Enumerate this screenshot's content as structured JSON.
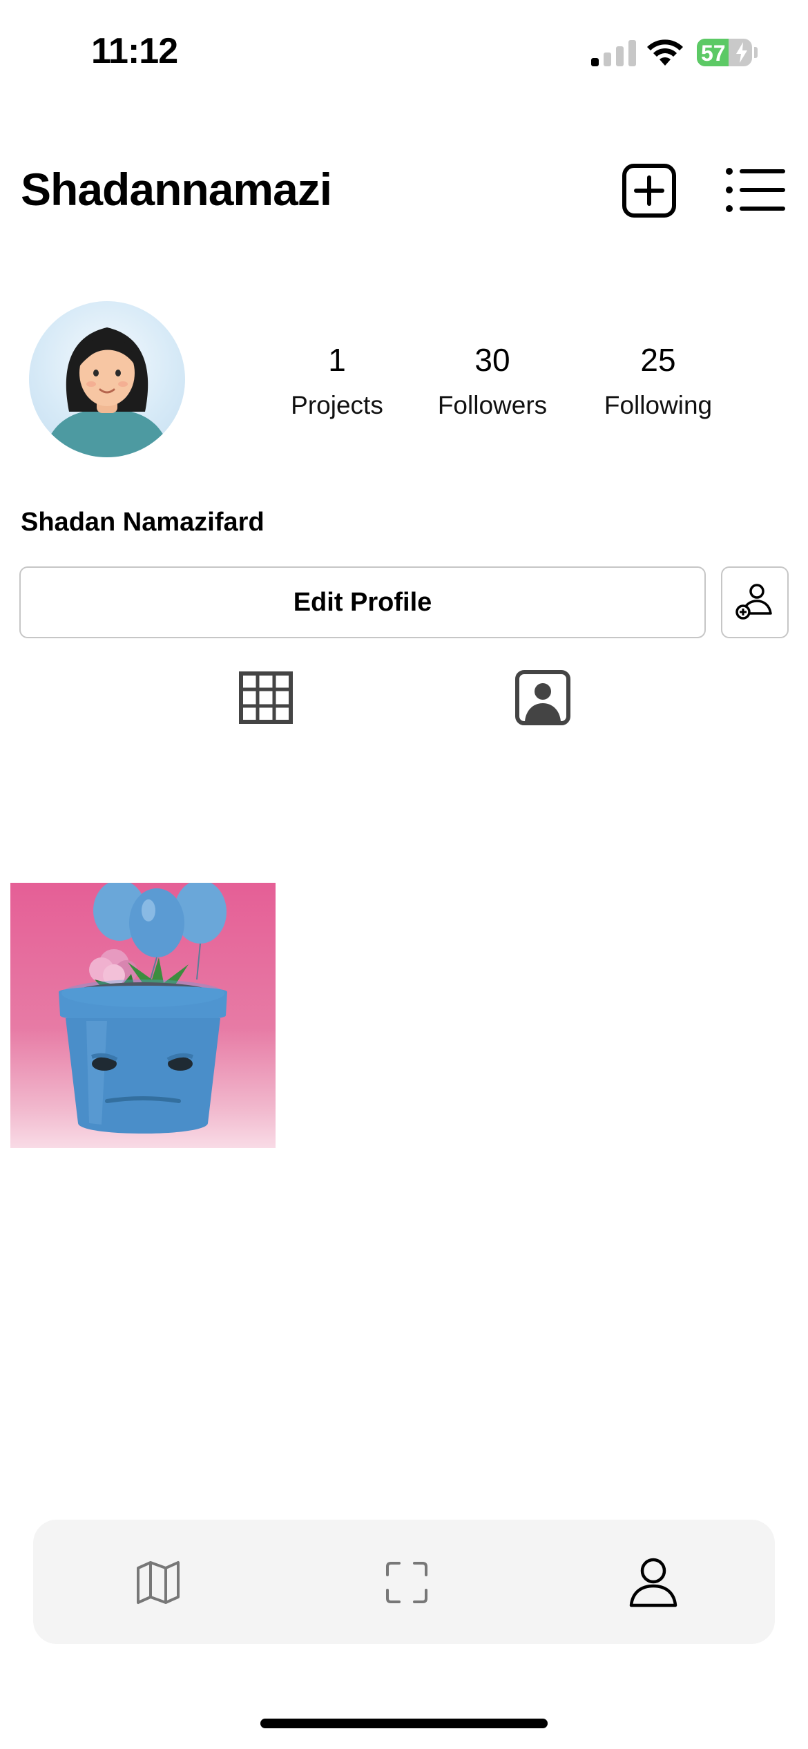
{
  "status_bar": {
    "time": "11:12",
    "battery_percent": "57",
    "battery_level": 0.57,
    "signal_bars_on": 1,
    "signal_bars_total": 4
  },
  "header": {
    "username": "Shadannamazi",
    "add_icon": "plus-square-icon",
    "menu_icon": "list-menu-icon"
  },
  "profile": {
    "full_name": "Shadan Namazifard",
    "avatar": "cartoon-woman-avatar",
    "stats": [
      {
        "value": "1",
        "label": "Projects"
      },
      {
        "value": "30",
        "label": "Followers"
      },
      {
        "value": "25",
        "label": "Following"
      }
    ],
    "edit_button_label": "Edit Profile",
    "add_user_icon": "add-user-icon"
  },
  "tabs": [
    {
      "icon": "grid-icon",
      "active": true
    },
    {
      "icon": "tagged-person-icon",
      "active": false
    }
  ],
  "posts": [
    {
      "image": "blue-flower-pot-with-balloons"
    }
  ],
  "bottom_nav": [
    {
      "icon": "map-icon",
      "active": false
    },
    {
      "icon": "scan-icon",
      "active": false
    },
    {
      "icon": "profile-icon",
      "active": true
    }
  ],
  "colors": {
    "battery_green": "#5cc965",
    "post_background": "#e55f96",
    "pot_blue": "#4f95d0",
    "tabbar_background": "#f4f4f4",
    "border_gray": "#c6c6c6"
  }
}
